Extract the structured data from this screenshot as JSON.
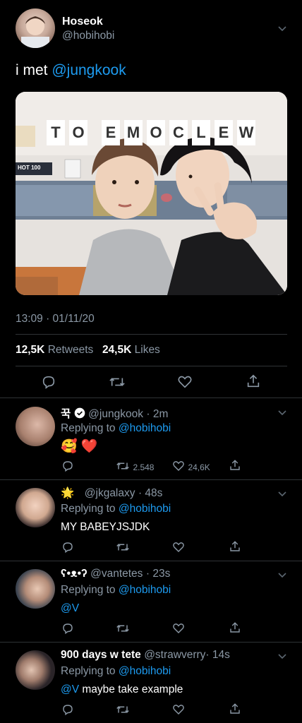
{
  "tweet": {
    "author_name": "Hoseok",
    "author_handle": "@hobihobi",
    "text_prefix": "i met ",
    "text_mention": "@jungkook",
    "photo_banner_letters": [
      "T",
      "O",
      "E",
      "M",
      "O",
      "C",
      "L",
      "E",
      "W"
    ],
    "photo_caption": "HOT 100",
    "timestamp": "13:09 · 01/11/20",
    "retweets_count": "12,5K",
    "retweets_label": "Retweets",
    "likes_count": "24,5K",
    "likes_label": "Likes"
  },
  "actions": {
    "reply_icon": "reply-icon",
    "retweet_icon": "retweet-icon",
    "like_icon": "heart-icon",
    "share_icon": "share-icon"
  },
  "replies": [
    {
      "name": "꾹",
      "verified": true,
      "handle": "@jungkook",
      "time": "· 2m",
      "replying_prefix": "Replying to ",
      "replying_to": "@hobihobi",
      "text": "🥰 ❤️",
      "retweet_count": "2.548",
      "like_count": "24,6K"
    },
    {
      "name": "🌟",
      "handle": "@jkgalaxy",
      "time": "· 48s",
      "replying_prefix": "Replying to ",
      "replying_to": "@hobihobi",
      "text": "MY BABEYJSJDK"
    },
    {
      "name": "ʕ•ᴥ•ʔ",
      "handle": "@vantetes",
      "time": "· 23s",
      "replying_prefix": "Replying to ",
      "replying_to": "@hobihobi",
      "mention": "@V",
      "text": ""
    },
    {
      "name": "900 days w tete",
      "handle": "@strawverry",
      "time": "· 14s",
      "replying_prefix": "Replying to ",
      "replying_to": "@hobihobi",
      "mention": "@V",
      "text": " maybe take example"
    }
  ],
  "colors": {
    "background": "#000000",
    "accent": "#1d9bf0",
    "muted": "#8b98a5",
    "divider": "#2f3336",
    "verified": "#ffffff",
    "heart": "#e0245e"
  }
}
